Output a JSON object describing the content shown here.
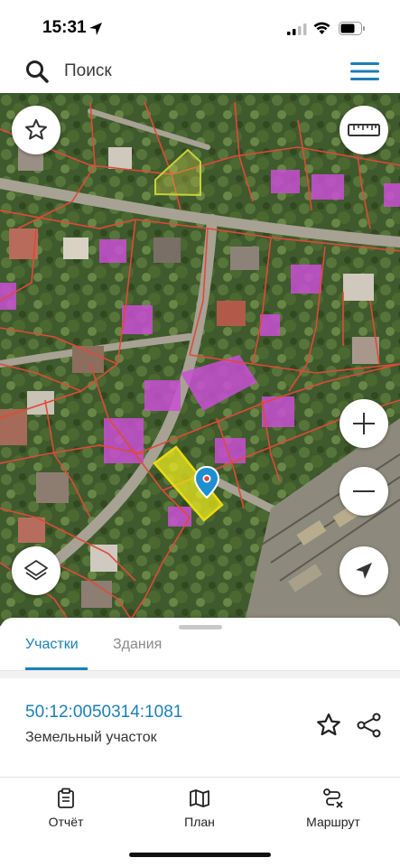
{
  "status_bar": {
    "time": "15:31"
  },
  "search": {
    "placeholder": "Поиск"
  },
  "tabs": [
    {
      "label": "Участки",
      "active": true
    },
    {
      "label": "Здания",
      "active": false
    }
  ],
  "parcel": {
    "number": "50:12:0050314:1081",
    "type": "Земельный участок"
  },
  "bottom_nav": [
    {
      "label": "Отчёт",
      "icon": "report-icon"
    },
    {
      "label": "План",
      "icon": "map-icon"
    },
    {
      "label": "Маршрут",
      "icon": "route-icon"
    }
  ],
  "colors": {
    "accent": "#1c7fb5",
    "parcel_border": "#e0493a",
    "selected_parcel": "#f4ef1c",
    "building_overlay": "#c94fd4",
    "marker": "#1d8fd1"
  }
}
